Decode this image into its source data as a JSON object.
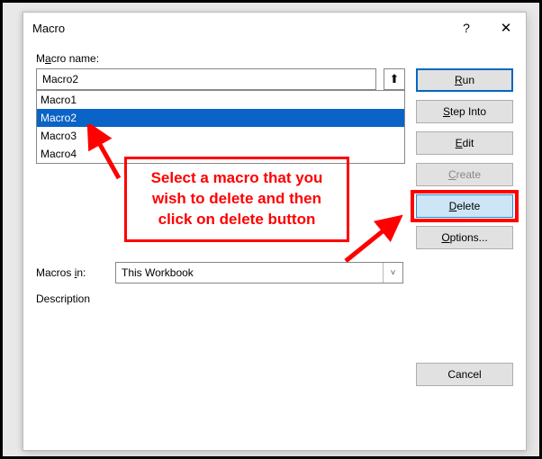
{
  "titlebar": {
    "title": "Macro",
    "help": "?",
    "close": "✕"
  },
  "labels": {
    "macro_name_pre": "M",
    "macro_name_u": "a",
    "macro_name_post": "cro name:",
    "macros_in_pre": "Macros ",
    "macros_in_u": "i",
    "macros_in_post": "n:",
    "description": "Description"
  },
  "name_input": {
    "value": "Macro2"
  },
  "list": {
    "items": [
      "Macro1",
      "Macro2",
      "Macro3",
      "Macro4"
    ],
    "selected_index": 1
  },
  "buttons": {
    "run_u": "R",
    "run_post": "un",
    "step_u": "S",
    "step_post": "tep Into",
    "edit_u": "E",
    "edit_post": "dit",
    "create_u": "C",
    "create_post": "reate",
    "delete_u": "D",
    "delete_post": "elete",
    "options_u": "O",
    "options_post": "ptions...",
    "cancel": "Cancel"
  },
  "macros_in": {
    "value": "This Workbook"
  },
  "annotation": {
    "text1": "Select a macro that you",
    "text2": "wish to delete and then",
    "text3": "click on delete button"
  },
  "icons": {
    "up": "⬆",
    "chev": "˅"
  }
}
